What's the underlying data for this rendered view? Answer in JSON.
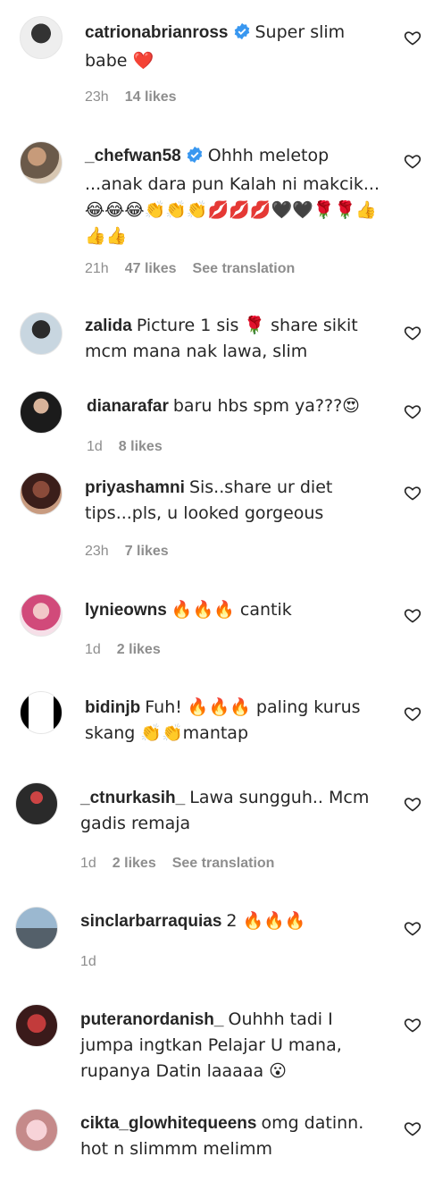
{
  "comments": [
    {
      "user": "catrionabrianross",
      "verified": true,
      "text": "Super slim babe ❤️",
      "time": "23h",
      "likes": "14 likes",
      "translate": ""
    },
    {
      "user": "_chefwan58",
      "verified": true,
      "text": "Ohhh meletop ...anak dara pun Kalah ni makcik...😂😂😂👏👏👏💋💋💋🖤🖤🌹🌹👍👍👍",
      "time": "21h",
      "likes": "47 likes",
      "translate": "See translation"
    },
    {
      "user": "zalida",
      "verified": false,
      "text": "Picture 1 sis 🌹 share sikit mcm mana nak lawa, slim",
      "time": "",
      "likes": "",
      "translate": ""
    },
    {
      "user": "dianarafar",
      "verified": false,
      "text": "baru hbs spm ya???😍",
      "time": "1d",
      "likes": "8 likes",
      "translate": ""
    },
    {
      "user": "priyashamni",
      "verified": false,
      "text": "Sis..share ur diet tips...pls, u looked gorgeous",
      "time": "23h",
      "likes": "7 likes",
      "translate": ""
    },
    {
      "user": "lynieowns",
      "verified": false,
      "text": "🔥🔥🔥 cantik",
      "time": "1d",
      "likes": "2 likes",
      "translate": ""
    },
    {
      "user": "bidinjb",
      "verified": false,
      "text": "Fuh! 🔥🔥🔥 paling kurus skang 👏👏mantap",
      "time": "",
      "likes": "",
      "translate": ""
    },
    {
      "user": "_ctnurkasih_",
      "verified": false,
      "text": "Lawa sungguh.. Mcm gadis remaja",
      "time": "1d",
      "likes": "2 likes",
      "translate": "See translation"
    },
    {
      "user": "sinclarbarraquias",
      "verified": false,
      "text": "2 🔥🔥🔥",
      "time": "1d",
      "likes": "",
      "translate": ""
    },
    {
      "user": "puteranordanish_",
      "verified": false,
      "text": "Ouhhh tadi I jumpa ingtkan Pelajar U mana, rupanya Datin laaaaa 😮",
      "time": "",
      "likes": "",
      "translate": ""
    },
    {
      "user": "cikta_glowhitequeens",
      "verified": false,
      "text": "omg datinn. hot n slimmm melimm",
      "time": "",
      "likes": "",
      "translate": ""
    }
  ],
  "colors": {
    "text": "#262626",
    "meta": "#8e8e8e",
    "verified": "#3897f0"
  },
  "icons": {
    "heart": "heart-outline-icon",
    "verified": "verified-badge-icon"
  }
}
